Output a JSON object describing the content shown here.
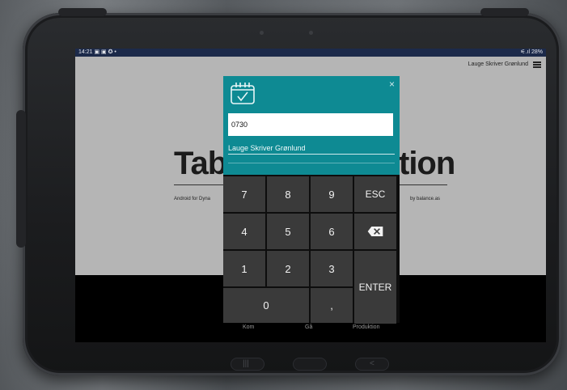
{
  "statusbar": {
    "time": "14:21",
    "indicators": "▣ ▣ ✪ •",
    "battery": "28%",
    "signal": "⚟.ıl"
  },
  "header": {
    "user_name": "Lauge Skriver Grønlund"
  },
  "background": {
    "title_left": "Tabl",
    "title_right": "tion",
    "subtitle_left": "Android for Dyna",
    "subtitle_right": "by balance.as"
  },
  "dialog": {
    "input_value": "0730",
    "name_text": "Lauge Skriver Grønlund",
    "close_glyph": "×"
  },
  "keypad": {
    "keys": [
      "7",
      "8",
      "9",
      "ESC",
      "4",
      "5",
      "6",
      "1",
      "2",
      "3",
      "ENTER",
      "0",
      ","
    ],
    "footer": {
      "left": "Kom",
      "center": "Gå",
      "right": "Produktion"
    }
  },
  "nav": {
    "left": "|||",
    "right": "<"
  },
  "colors": {
    "dialog_bg": "#0e8a93",
    "key_bg": "#3a3a3a",
    "statusbar_bg": "#1c2a4a"
  }
}
